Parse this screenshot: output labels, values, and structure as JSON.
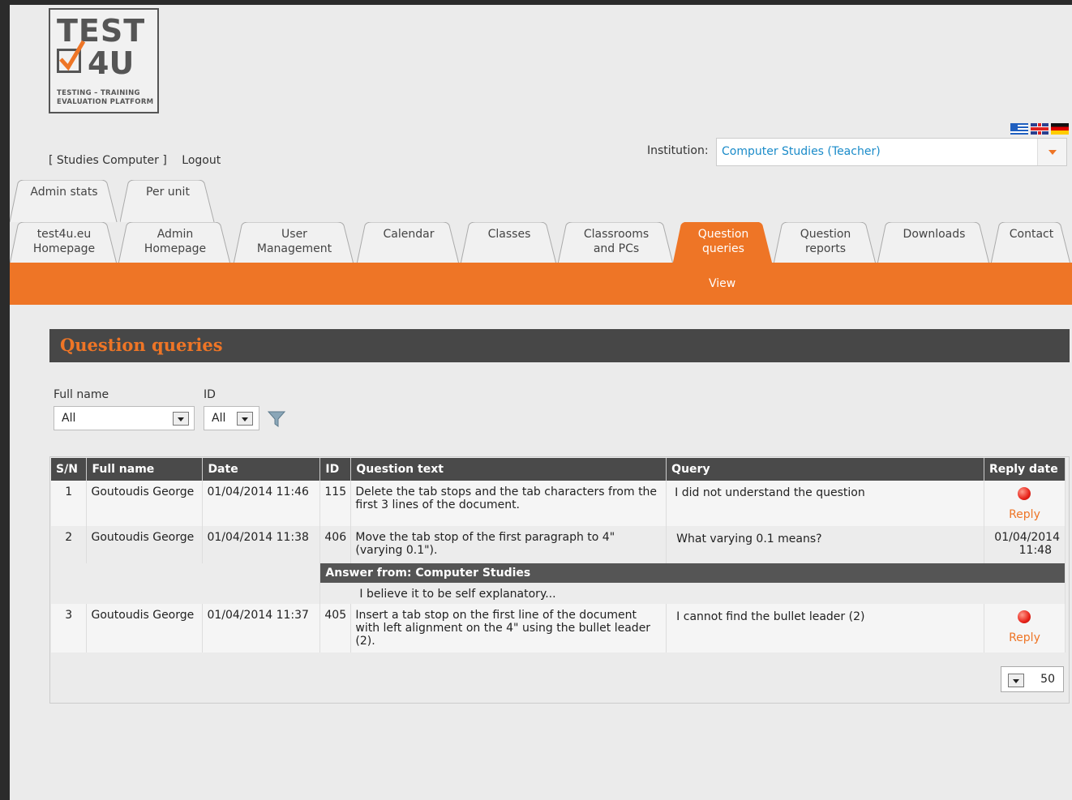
{
  "logo": {
    "line1": "TEST",
    "line2": "4U",
    "tagline1": "TESTING – TRAINING",
    "tagline2": "EVALUATION PLATFORM"
  },
  "languages": [
    "Greek",
    "English",
    "German"
  ],
  "user": {
    "name": "[ Studies Computer ]",
    "logout": "Logout"
  },
  "institution": {
    "label": "Institution:",
    "value": "Computer Studies (Teacher)"
  },
  "tabs_top": [
    {
      "label": "Admin stats"
    },
    {
      "label": "Per unit"
    }
  ],
  "tabs_main": [
    {
      "line1": "test4u.eu",
      "line2": "Homepage"
    },
    {
      "line1": "Admin",
      "line2": "Homepage"
    },
    {
      "line1": "User",
      "line2": "Management"
    },
    {
      "line1": "Calendar",
      "line2": ""
    },
    {
      "line1": "Classes",
      "line2": ""
    },
    {
      "line1": "Classrooms",
      "line2": "and PCs"
    },
    {
      "line1": "Question",
      "line2": "queries"
    },
    {
      "line1": "Question",
      "line2": "reports"
    },
    {
      "line1": "Downloads",
      "line2": ""
    },
    {
      "line1": "Contact",
      "line2": ""
    }
  ],
  "active_tab": "Question queries",
  "subnav": {
    "view": "View"
  },
  "heading": "Question queries",
  "filters": {
    "fullname_label": "Full name",
    "fullname_value": "All",
    "id_label": "ID",
    "id_value": "All"
  },
  "table": {
    "headers": [
      "S/N",
      "Full name",
      "Date",
      "ID",
      "Question text",
      "Query",
      "Reply date"
    ],
    "rows": [
      {
        "sn": "1",
        "name": "Goutoudis George",
        "date": "01/04/2014 11:46",
        "id": "115",
        "question": "Delete the tab stops and the tab characters from the first 3 lines of the document.",
        "query": "I did not understand the question",
        "reply": "Reply"
      },
      {
        "sn": "2",
        "name": "Goutoudis George",
        "date": "01/04/2014 11:38",
        "id": "406",
        "question": "Move the tab stop of the first paragraph to 4\" (varying 0.1\").",
        "query": "What varying 0.1 means?",
        "reply_date": "01/04/2014",
        "reply_time": "11:48",
        "answer_from": "Answer from: Computer Studies",
        "answer_text": "I believe it to be self explanatory..."
      },
      {
        "sn": "3",
        "name": "Goutoudis George",
        "date": "01/04/2014 11:37",
        "id": "405",
        "question": "Insert a tab stop on the first line of the document with left alignment on the 4\" using the bullet leader (2).",
        "query": "I cannot find the bullet leader (2)",
        "reply": "Reply"
      }
    ]
  },
  "pager": {
    "page_size": "50"
  },
  "colors": {
    "accent": "#ee7526",
    "header_bg": "#474747",
    "link": "#1a8bc9"
  }
}
